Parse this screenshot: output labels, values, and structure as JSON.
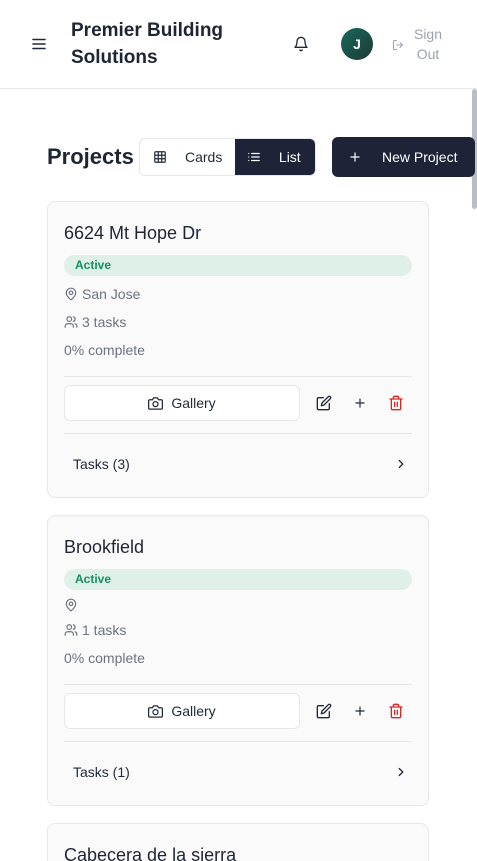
{
  "header": {
    "brand": "Premier Building Solutions",
    "avatar_initial": "J",
    "signout_label": "Sign Out"
  },
  "toolbar": {
    "title": "Projects",
    "view_cards_label": "Cards",
    "view_list_label": "List",
    "active_view": "List",
    "new_project_label": "New Project"
  },
  "projects": [
    {
      "name": "6624 Mt Hope Dr",
      "status": "Active",
      "location": "San Jose",
      "tasks_count": "3 tasks",
      "progress": "0% complete",
      "gallery_label": "Gallery",
      "tasks_label": "Tasks (3)"
    },
    {
      "name": "Brookfield",
      "status": "Active",
      "location": "",
      "tasks_count": "1 tasks",
      "progress": "0% complete",
      "gallery_label": "Gallery",
      "tasks_label": "Tasks (1)"
    },
    {
      "name": "Cabecera de la sierra"
    }
  ],
  "colors": {
    "primary": "#1e2338",
    "active_badge_bg": "#dff0e8",
    "active_badge_text": "#15915f",
    "delete_icon": "#dc2626"
  }
}
